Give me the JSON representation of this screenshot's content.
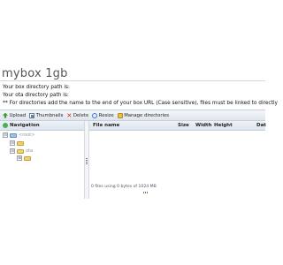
{
  "page": {
    "title": "mybox 1gb",
    "box_path_label": "Your box directory path is:",
    "ota_path_label": "Your ota directory path is:",
    "note": "** For directories add the name to the end of your box URL (Case sensitive), files must be linked to directly"
  },
  "toolbar": {
    "items": [
      {
        "label": "Upload",
        "icon": "upload-icon"
      },
      {
        "label": "Thumbnails",
        "icon": "thumbnails-icon"
      },
      {
        "label": "Delete",
        "icon": "delete-icon"
      },
      {
        "label": "Resize",
        "icon": "resize-icon"
      },
      {
        "label": "Manage directories",
        "icon": "manage-directories-icon"
      }
    ]
  },
  "navigation": {
    "header": "Navigation",
    "tree": [
      {
        "label": "<root>",
        "toggle": "⊟"
      },
      {
        "label": "",
        "toggle": "⊟"
      },
      {
        "label": "ota",
        "toggle": "⊟"
      },
      {
        "label": "",
        "toggle": "⊞"
      }
    ]
  },
  "file_list": {
    "columns": [
      "File name",
      "Size",
      "Width",
      "Height",
      "Dat"
    ],
    "status": "0 files using 0 bytes of 1024 MB"
  }
}
